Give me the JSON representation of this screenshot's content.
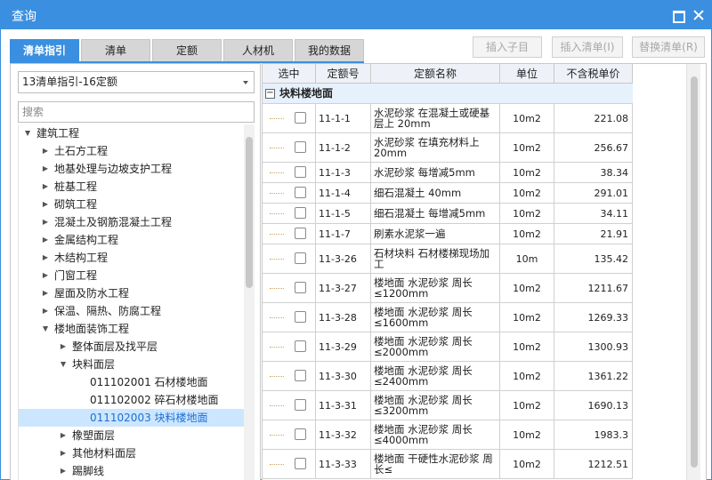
{
  "window": {
    "title": "查询"
  },
  "tabs": [
    "清单指引",
    "清单",
    "定额",
    "人材机",
    "我的数据"
  ],
  "toolbar": {
    "insert_child": "插入子目",
    "insert_list": "插入清单(I)",
    "replace_list": "替换清单(R)"
  },
  "left": {
    "combo_value": "13清单指引-16定额",
    "search_placeholder": "搜索"
  },
  "tree": [
    {
      "label": "建筑工程",
      "toggle": "▲"
    },
    {
      "label": "土石方工程",
      "toggle": "▶"
    },
    {
      "label": "地基处理与边坡支护工程",
      "toggle": "▶"
    },
    {
      "label": "桩基工程",
      "toggle": "▶"
    },
    {
      "label": "砌筑工程",
      "toggle": "▶"
    },
    {
      "label": "混凝土及钢筋混凝土工程",
      "toggle": "▶"
    },
    {
      "label": "金属结构工程",
      "toggle": "▶"
    },
    {
      "label": "木结构工程",
      "toggle": "▶"
    },
    {
      "label": "门窗工程",
      "toggle": "▶"
    },
    {
      "label": "屋面及防水工程",
      "toggle": "▶"
    },
    {
      "label": "保温、隔热、防腐工程",
      "toggle": "▶"
    },
    {
      "label": "楼地面装饰工程",
      "toggle": "▲"
    },
    {
      "label": "整体面层及找平层",
      "toggle": "▶"
    },
    {
      "label": "块料面层",
      "toggle": "▲"
    },
    {
      "label": "011102001  石材楼地面",
      "toggle": ""
    },
    {
      "label": "011102002  碎石材楼地面",
      "toggle": ""
    },
    {
      "label": "011102003  块料楼地面",
      "toggle": ""
    },
    {
      "label": "橡塑面层",
      "toggle": "▶"
    },
    {
      "label": "其他材料面层",
      "toggle": "▶"
    },
    {
      "label": "踢脚线",
      "toggle": "▶"
    }
  ],
  "grid": {
    "headers": [
      "选中",
      "定额号",
      "定额名称",
      "单位",
      "不含税单价"
    ],
    "group": "块料楼地面",
    "rows": [
      {
        "code": "11-1-1",
        "name": "水泥砂浆 在混凝土或硬基层上 20mm",
        "unit": "10m2",
        "price": "221.08"
      },
      {
        "code": "11-1-2",
        "name": "水泥砂浆 在填充材料上 20mm",
        "unit": "10m2",
        "price": "256.67"
      },
      {
        "code": "11-1-3",
        "name": "水泥砂浆 每增减5mm",
        "unit": "10m2",
        "price": "38.34"
      },
      {
        "code": "11-1-4",
        "name": "细石混凝土 40mm",
        "unit": "10m2",
        "price": "291.01"
      },
      {
        "code": "11-1-5",
        "name": "细石混凝土 每增减5mm",
        "unit": "10m2",
        "price": "34.11"
      },
      {
        "code": "11-1-7",
        "name": "刷素水泥浆一遍",
        "unit": "10m2",
        "price": "21.91"
      },
      {
        "code": "11-3-26",
        "name": "石材块料 石材楼梯现场加工",
        "unit": "10m",
        "price": "135.42"
      },
      {
        "code": "11-3-27",
        "name": "楼地面 水泥砂浆 周长≤1200mm",
        "unit": "10m2",
        "price": "1211.67"
      },
      {
        "code": "11-3-28",
        "name": "楼地面 水泥砂浆 周长≤1600mm",
        "unit": "10m2",
        "price": "1269.33"
      },
      {
        "code": "11-3-29",
        "name": "楼地面 水泥砂浆 周长≤2000mm",
        "unit": "10m2",
        "price": "1300.93"
      },
      {
        "code": "11-3-30",
        "name": "楼地面 水泥砂浆 周长≤2400mm",
        "unit": "10m2",
        "price": "1361.22"
      },
      {
        "code": "11-3-31",
        "name": "楼地面 水泥砂浆 周长≤3200mm",
        "unit": "10m2",
        "price": "1690.13"
      },
      {
        "code": "11-3-32",
        "name": "楼地面 水泥砂浆 周长≤4000mm",
        "unit": "10m2",
        "price": "1983.3"
      },
      {
        "code": "11-3-33",
        "name": "楼地面 干硬性水泥砂浆 周长≤",
        "unit": "10m2",
        "price": "1212.51"
      }
    ]
  }
}
